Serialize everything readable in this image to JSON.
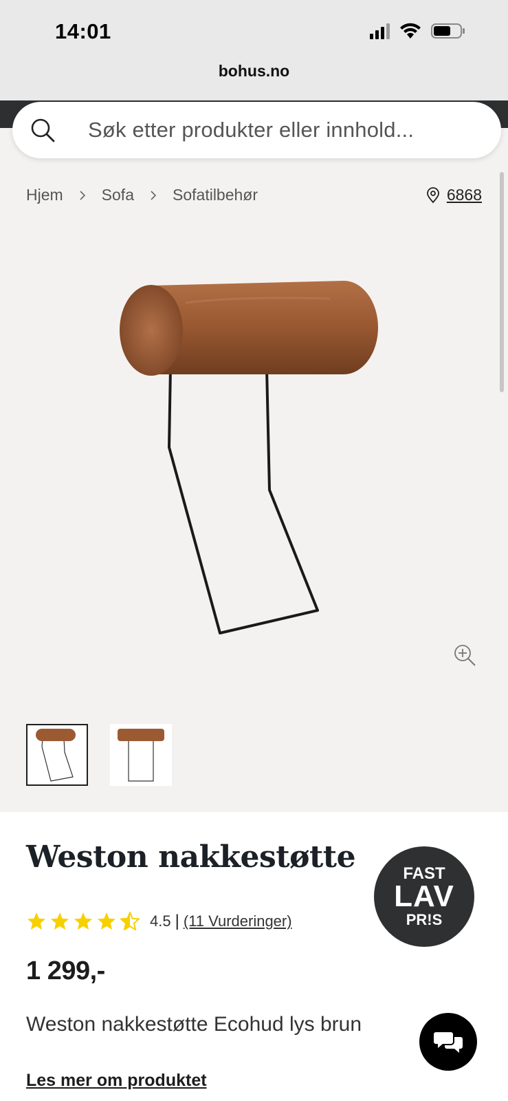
{
  "status_bar": {
    "time": "14:01"
  },
  "browser": {
    "url": "bohus.no"
  },
  "search": {
    "placeholder": "Søk etter produkter eller innhold..."
  },
  "breadcrumb": [
    "Hjem",
    "Sofa",
    "Sofatilbehør"
  ],
  "store": {
    "code": "6868"
  },
  "product": {
    "title": "Weston nakkestøtte",
    "rating_value": "4.5",
    "rating_separator": "|",
    "reviews_link": "(11 Vurderinger)",
    "price": "1 299,-",
    "description": "Weston nakkestøtte Ecohud lys brun",
    "read_more": "Les mer om produktet",
    "stars": 4.5
  },
  "badge": {
    "line1": "FAST",
    "line2": "LAV",
    "line3": "PR!S"
  },
  "thumbnails": [
    "thumbnail-1",
    "thumbnail-2"
  ],
  "colors": {
    "leather": "#9c5a33",
    "frame": "#1a1a1a",
    "star": "#f7d000",
    "badge": "#2f3032",
    "page_bg": "#f4f2f0"
  },
  "icons": [
    "search-icon",
    "chevron-right-icon",
    "location-pin-icon",
    "zoom-in-icon",
    "star-icon",
    "chat-icon",
    "wifi-icon",
    "battery-icon",
    "signal-icon"
  ]
}
